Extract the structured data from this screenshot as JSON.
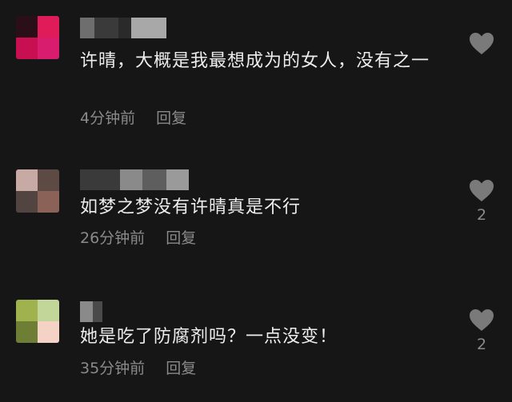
{
  "comments": [
    {
      "text": "许晴，大概是我最想成为的女人，没有之一",
      "time": "4分钟前",
      "reply_label": "回复",
      "like_count": "",
      "avatar_colors": [
        "#2a0f18",
        "#e01b5a",
        "#c70f52",
        "#d81c6e"
      ],
      "username_blur_colors": [
        "#6e6e6e",
        "#9a9a9a",
        "#3a3a3a",
        "#a8a8a8"
      ]
    },
    {
      "text": "如梦之梦没有许晴真是不行",
      "time": "26分钟前",
      "reply_label": "回复",
      "like_count": "2",
      "avatar_colors": [
        "#c7aaa4",
        "#5e4a44",
        "#524440",
        "#8a6258"
      ],
      "username_blur_colors": [
        "#5a5a5a",
        "#8a8a8a",
        "#6e6e6e",
        "#9a9a9a"
      ]
    },
    {
      "text": "她是吃了防腐剂吗？一点没变！",
      "time": "35分钟前",
      "reply_label": "回复",
      "like_count": "2",
      "avatar_colors": [
        "#9fb24e",
        "#c3d69a",
        "#6e7e34",
        "#f4d2c6"
      ],
      "username_blur_colors": [
        "#8a8a8a",
        "#5a5a5a"
      ]
    }
  ]
}
